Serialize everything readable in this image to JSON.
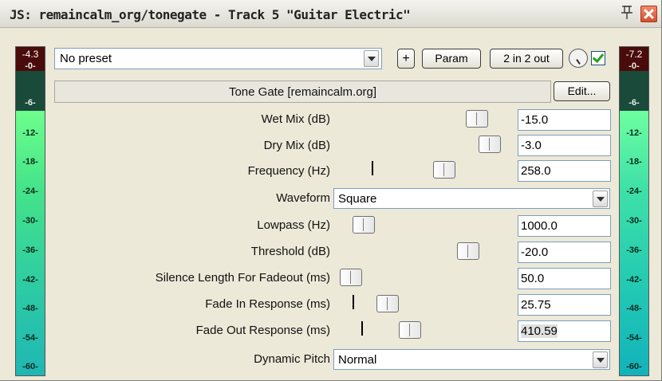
{
  "window": {
    "title": "JS: remaincalm_org/tonegate - Track 5 \"Guitar Electric\""
  },
  "meters": {
    "left_peak": "-4.3",
    "right_peak": "-7.2",
    "ticks": [
      "-0-",
      "-6-",
      "-12-",
      "-18-",
      "-24-",
      "-30-",
      "-36-",
      "-42-",
      "-48-",
      "-54-",
      "-60-"
    ]
  },
  "toolbar": {
    "preset": "No preset",
    "add_label": "+",
    "param_label": "Param",
    "io_label": "2 in 2 out",
    "enabled": true
  },
  "plugin": {
    "name": "Tone Gate [remaincalm.org]",
    "edit_label": "Edit..."
  },
  "params": [
    {
      "label": "Wet Mix (dB)",
      "value": "-15.0"
    },
    {
      "label": "Dry Mix (dB)",
      "value": "-3.0"
    },
    {
      "label": "Frequency (Hz)",
      "value": "258.0"
    },
    {
      "label": "Waveform",
      "value": "Square"
    },
    {
      "label": "Lowpass (Hz)",
      "value": "1000.0"
    },
    {
      "label": "Threshold (dB)",
      "value": "-20.0"
    },
    {
      "label": "Silence Length For Fadeout (ms)",
      "value": "50.0"
    },
    {
      "label": "Fade In Response (ms)",
      "value": "25.75"
    },
    {
      "label": "Fade Out Response (ms)",
      "value": "410.59"
    },
    {
      "label": "Dynamic Pitch",
      "value": "Normal"
    }
  ]
}
